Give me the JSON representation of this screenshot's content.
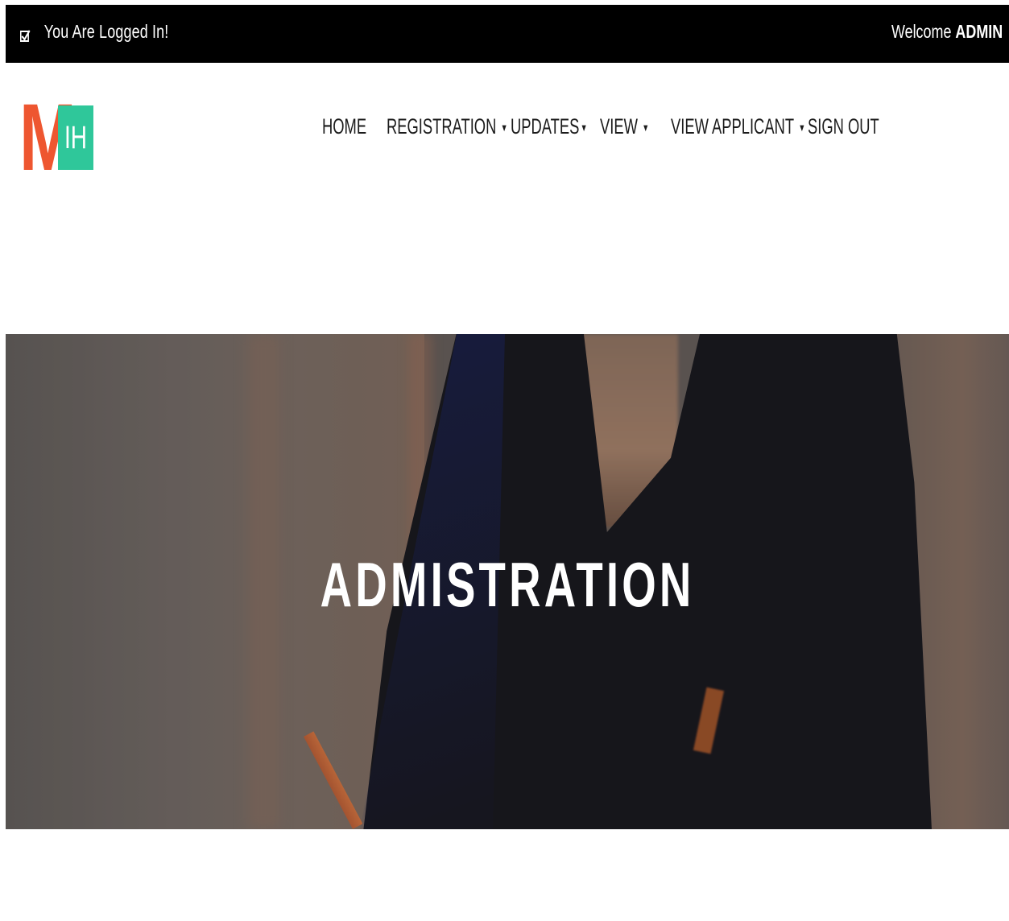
{
  "topbar": {
    "status_text": "You Are Logged In!",
    "welcome_prefix": "Welcome",
    "username": "ADMIN"
  },
  "logo": {
    "big_letter": "M",
    "box_letters": "IH",
    "colors": {
      "m": "#ee5630",
      "box": "#2fc79a"
    }
  },
  "nav": {
    "items": [
      {
        "label": "HOME",
        "has_caret": false
      },
      {
        "label": "REGISTRATION",
        "has_caret": true
      },
      {
        "label": "UPDATES",
        "has_caret": true
      },
      {
        "label": "VIEW",
        "has_caret": true
      },
      {
        "label": "VIEW APPLICANT",
        "has_caret": true
      },
      {
        "label": "SIGN OUT",
        "has_caret": false
      }
    ],
    "caret_icon": "caret-down-icon"
  },
  "hero": {
    "title": "ADMISTRATION"
  }
}
